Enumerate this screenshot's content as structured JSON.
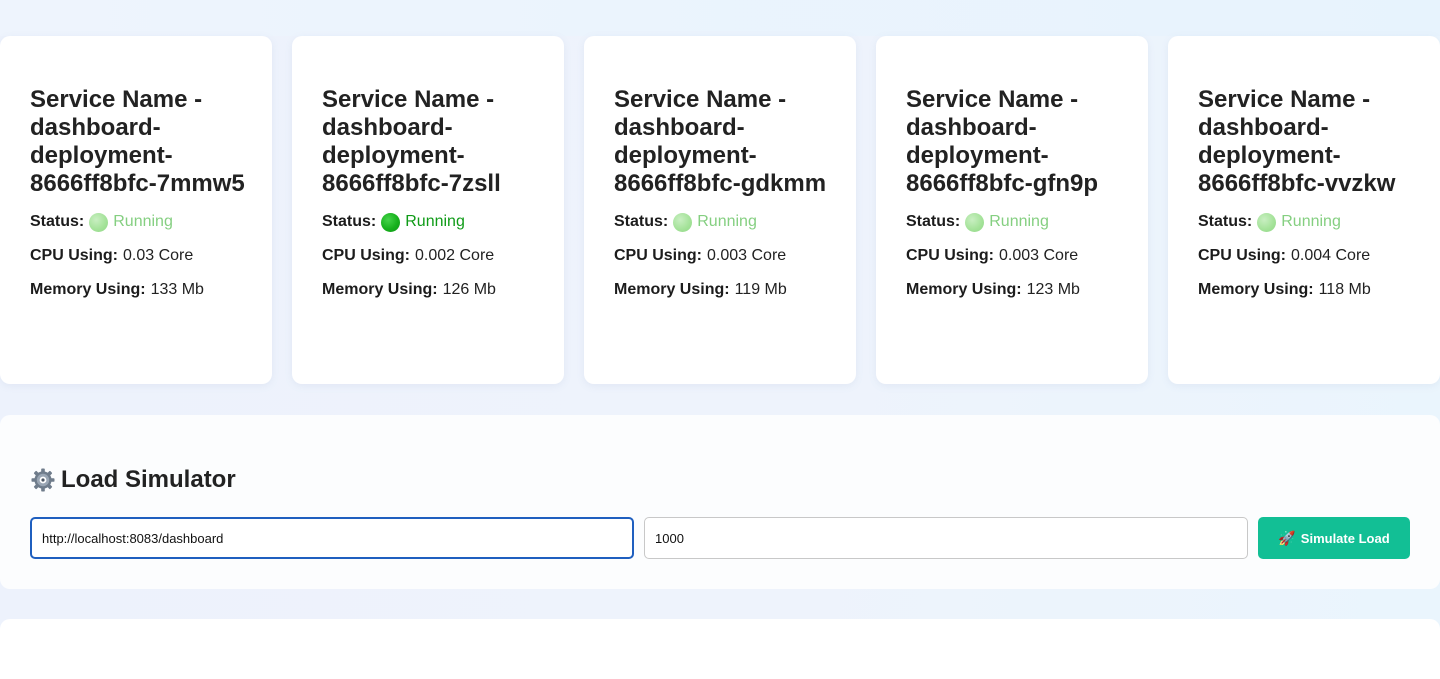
{
  "services": [
    {
      "title": "Service Name - dashboard-deployment-8666ff8bfc-7mmw5",
      "status_label": "Status:",
      "status": "Running",
      "status_style": "dim",
      "cpu_label": "CPU Using:",
      "cpu": "0.03 Core",
      "memory_label": "Memory Using:",
      "memory": "133 Mb"
    },
    {
      "title": "Service Name - dashboard-deployment-8666ff8bfc-7zsll",
      "status_label": "Status:",
      "status": "Running",
      "status_style": "bright",
      "cpu_label": "CPU Using:",
      "cpu": "0.002 Core",
      "memory_label": "Memory Using:",
      "memory": "126 Mb"
    },
    {
      "title": "Service Name - dashboard-deployment-8666ff8bfc-gdkmm",
      "status_label": "Status:",
      "status": "Running",
      "status_style": "dim",
      "cpu_label": "CPU Using:",
      "cpu": "0.003 Core",
      "memory_label": "Memory Using:",
      "memory": "119 Mb"
    },
    {
      "title": "Service Name - dashboard-deployment-8666ff8bfc-gfn9p",
      "status_label": "Status:",
      "status": "Running",
      "status_style": "dim",
      "cpu_label": "CPU Using:",
      "cpu": "0.003 Core",
      "memory_label": "Memory Using:",
      "memory": "123 Mb"
    },
    {
      "title": "Service Name - dashboard-deployment-8666ff8bfc-vvzkw",
      "status_label": "Status:",
      "status": "Running",
      "status_style": "dim",
      "cpu_label": "CPU Using:",
      "cpu": "0.004 Core",
      "memory_label": "Memory Using:",
      "memory": "118 Mb"
    }
  ],
  "status_colors": {
    "dim": "#85cf81",
    "bright": "#0f9b17"
  },
  "load_simulator": {
    "icon": "gear-icon",
    "title": "Load Simulator",
    "url_value": "http://localhost:8083/dashboard",
    "count_value": "1000",
    "button_icon": "rocket-icon",
    "button_label": "Simulate Load",
    "button_color": "#12bf95"
  }
}
